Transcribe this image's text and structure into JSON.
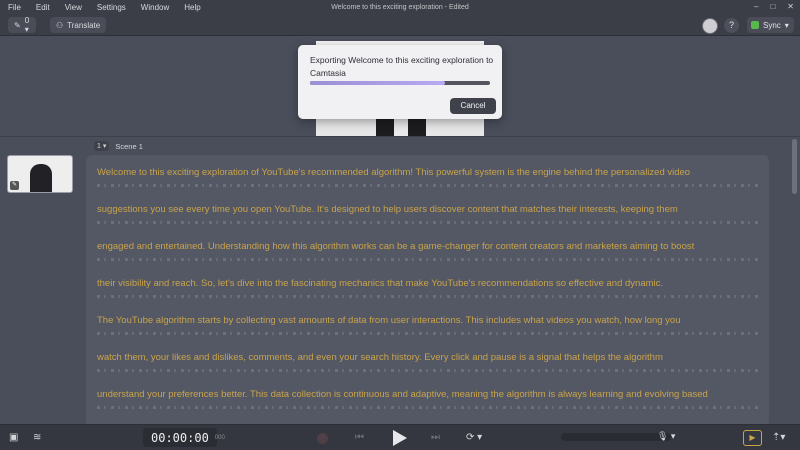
{
  "menu": {
    "items": [
      "File",
      "Edit",
      "View",
      "Settings",
      "Window",
      "Help"
    ]
  },
  "window": {
    "title": "Welcome to this exciting exploration - Edited",
    "controls": [
      "–",
      "□",
      "✕"
    ]
  },
  "toolbar": {
    "pencil_label": "0 ▾",
    "translate_label": "Translate",
    "help_label": "?",
    "sync_label": "Sync",
    "sync_menu": "▾"
  },
  "export_dialog": {
    "title": "Exporting Welcome to this exciting exploration to Camtasia",
    "progress_fraction": 0.75,
    "cancel_label": "Cancel"
  },
  "scene": {
    "number": "1 ▾",
    "label": "Scene 1"
  },
  "script": {
    "paragraphs": [
      {
        "lines": [
          "Welcome to this exciting exploration of YouTube's recommended algorithm! This powerful system is the engine behind the personalized video",
          "suggestions you see every time you open YouTube. It's designed to help users discover content that matches their interests, keeping them",
          "engaged and entertained. Understanding how this algorithm works can be a game-changer for content creators and marketers aiming to boost",
          "their visibility and reach. So, let's dive into the fascinating mechanics that make YouTube's recommendations so effective and dynamic."
        ]
      },
      {
        "lines": [
          "The YouTube algorithm starts by collecting vast amounts of data from user interactions. This includes what videos you watch, how long you",
          "watch them, your likes and dislikes, comments, and even your search history. Every click and pause is a signal that helps the algorithm",
          "understand your preferences better. This data collection is continuous and adaptive, meaning the algorithm is always learning and evolving based"
        ]
      }
    ]
  },
  "player": {
    "time": "00:00:00",
    "ms": "000",
    "prev_icon": "⏮",
    "next_icon": "⏭",
    "loop_icon": "⟳ ▾",
    "mic_icon": "🎙 ▾"
  },
  "bottom_right": {
    "preview_icon": "▶",
    "more_icon": "⇡▾"
  },
  "bottom_left": {
    "video_icon": "▣",
    "audio_icon": "≋"
  }
}
